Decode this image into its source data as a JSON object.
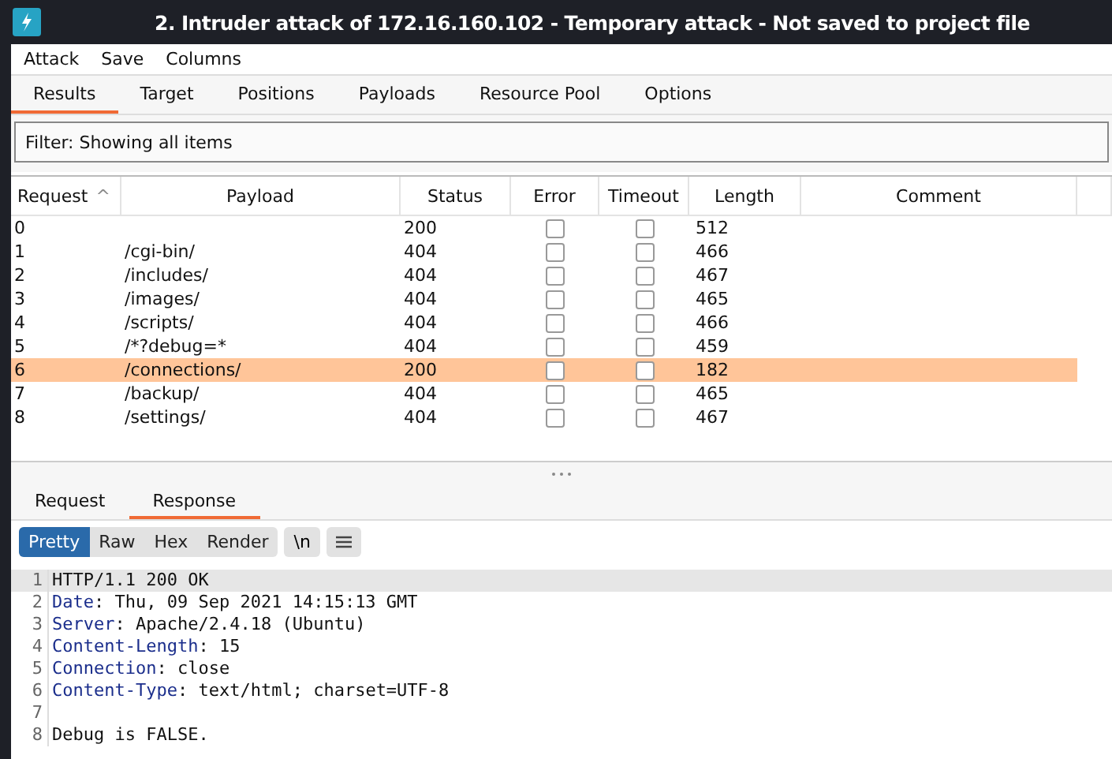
{
  "window": {
    "title": "2. Intruder attack of 172.16.160.102 - Temporary attack - Not saved to project file"
  },
  "menu": [
    "Attack",
    "Save",
    "Columns"
  ],
  "tabs": [
    {
      "label": "Results",
      "selected": true
    },
    {
      "label": "Target",
      "selected": false
    },
    {
      "label": "Positions",
      "selected": false
    },
    {
      "label": "Payloads",
      "selected": false
    },
    {
      "label": "Resource Pool",
      "selected": false
    },
    {
      "label": "Options",
      "selected": false
    }
  ],
  "filter": "Filter: Showing all items",
  "table": {
    "columns": [
      "Request",
      "Payload",
      "Status",
      "Error",
      "Timeout",
      "Length",
      "Comment"
    ],
    "sort_indicator": "^",
    "rows": [
      {
        "request": "0",
        "status": "200",
        "error": false,
        "timeout": false,
        "length": "512",
        "selected": false
      },
      {
        "request": "1",
        "payload": "/cgi-bin/",
        "status": "404",
        "error": false,
        "timeout": false,
        "length": "466",
        "selected": false
      },
      {
        "request": "2",
        "payload": "/includes/",
        "status": "404",
        "error": false,
        "timeout": false,
        "length": "467",
        "selected": false
      },
      {
        "request": "3",
        "payload": "/images/",
        "status": "404",
        "error": false,
        "timeout": false,
        "length": "465",
        "selected": false
      },
      {
        "request": "4",
        "payload": "/scripts/",
        "status": "404",
        "error": false,
        "timeout": false,
        "length": "466",
        "selected": false
      },
      {
        "request": "5",
        "payload": "/*?debug=*",
        "status": "404",
        "error": false,
        "timeout": false,
        "length": "459",
        "selected": false
      },
      {
        "request": "6",
        "payload": "/connections/",
        "status": "200",
        "error": false,
        "timeout": false,
        "length": "182",
        "selected": true
      },
      {
        "request": "7",
        "payload": "/backup/",
        "status": "404",
        "error": false,
        "timeout": false,
        "length": "465",
        "selected": false
      },
      {
        "request": "8",
        "payload": "/settings/",
        "status": "404",
        "error": false,
        "timeout": false,
        "length": "467",
        "selected": false
      }
    ]
  },
  "detail_tabs": [
    {
      "label": "Request",
      "selected": false
    },
    {
      "label": "Response",
      "selected": true
    }
  ],
  "view_modes": [
    {
      "label": "Pretty",
      "selected": true
    },
    {
      "label": "Raw",
      "selected": false
    },
    {
      "label": "Hex",
      "selected": false
    },
    {
      "label": "Render",
      "selected": false
    }
  ],
  "newline_button": "\\n",
  "response_lines": [
    {
      "number": "1",
      "text": "HTTP/1.1 200 OK"
    },
    {
      "number": "2",
      "name": "Date",
      "text": ": Thu, 09 Sep 2021 14:15:13 GMT"
    },
    {
      "number": "3",
      "name": "Server",
      "text": ": Apache/2.4.18 (Ubuntu)"
    },
    {
      "number": "4",
      "name": "Content-Length",
      "text": ": 15"
    },
    {
      "number": "5",
      "name": "Connection",
      "text": ": close"
    },
    {
      "number": "6",
      "name": "Content-Type",
      "text": ": text/html; charset=UTF-8"
    },
    {
      "number": "7"
    },
    {
      "number": "8",
      "text": "Debug is FALSE."
    }
  ]
}
